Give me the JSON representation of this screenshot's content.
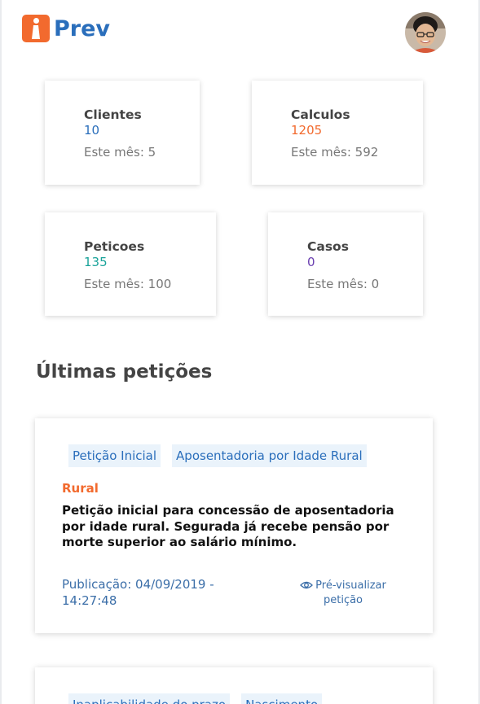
{
  "header": {
    "logo_text": "Prev",
    "brand_color": "#2a6ebb",
    "logo_color": "#f26a2e"
  },
  "stats": [
    {
      "title": "Clientes",
      "value": "10",
      "sub": "Este mês: 5",
      "color": "#2a6ebb"
    },
    {
      "title": "Calculos",
      "value": "1205",
      "sub": "Este mês: 592",
      "color": "#f26a2e"
    },
    {
      "title": "Peticoes",
      "value": "135",
      "sub": "Este mês: 100",
      "color": "#1aa39a"
    },
    {
      "title": "Casos",
      "value": "0",
      "sub": "Este mês: 0",
      "color": "#6a3fb0"
    }
  ],
  "section_title": "Últimas petições",
  "petitions": [
    {
      "tags": [
        "Petição Inicial",
        "Aposentadoria por Idade Rural"
      ],
      "category": "Rural",
      "description": "Petição inicial para concessão de aposentadoria por idade rural. Segurada já recebe pensão por morte superior ao salário mínimo.",
      "date": "Publicação: 04/09/2019 - 14:27:48",
      "preview_label": "Pré-visualizar petição",
      "preview_icon": "eye-icon"
    },
    {
      "tags": [
        "Inaplicabilidade do prazo",
        "Nascimento"
      ]
    }
  ]
}
